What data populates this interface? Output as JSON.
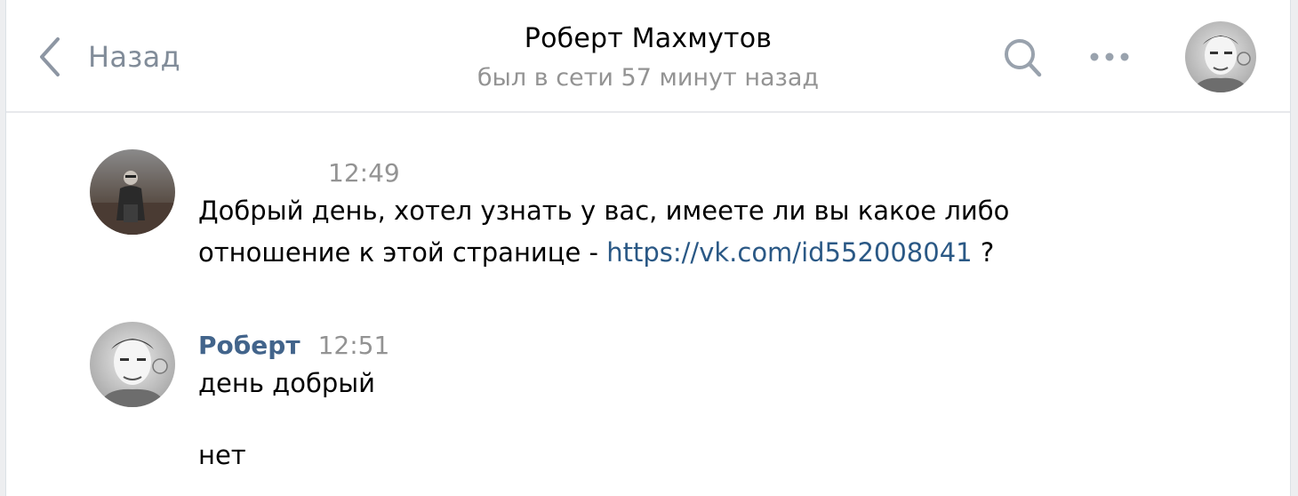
{
  "header": {
    "back_label": "Назад",
    "title": "Роберт Махмутов",
    "subtitle": "был в сети 57 минут назад",
    "icons": [
      "chevron-left-icon",
      "search-icon",
      "more-icon"
    ]
  },
  "messages": [
    {
      "time": "12:49",
      "text_part1": "Добрый день, хотел узнать у вас, имеете ли вы какое либо",
      "text_part2": "отношение к этой странице - ",
      "link": "https://vk.com/id552008041",
      "text_tail": " ?"
    },
    {
      "author": "Роберт",
      "time": "12:51",
      "line1": "день добрый",
      "line2": "нет"
    }
  ],
  "colors": {
    "link": "#2a5885",
    "author": "#42648b",
    "muted": "#939393",
    "icon": "#818c99"
  }
}
